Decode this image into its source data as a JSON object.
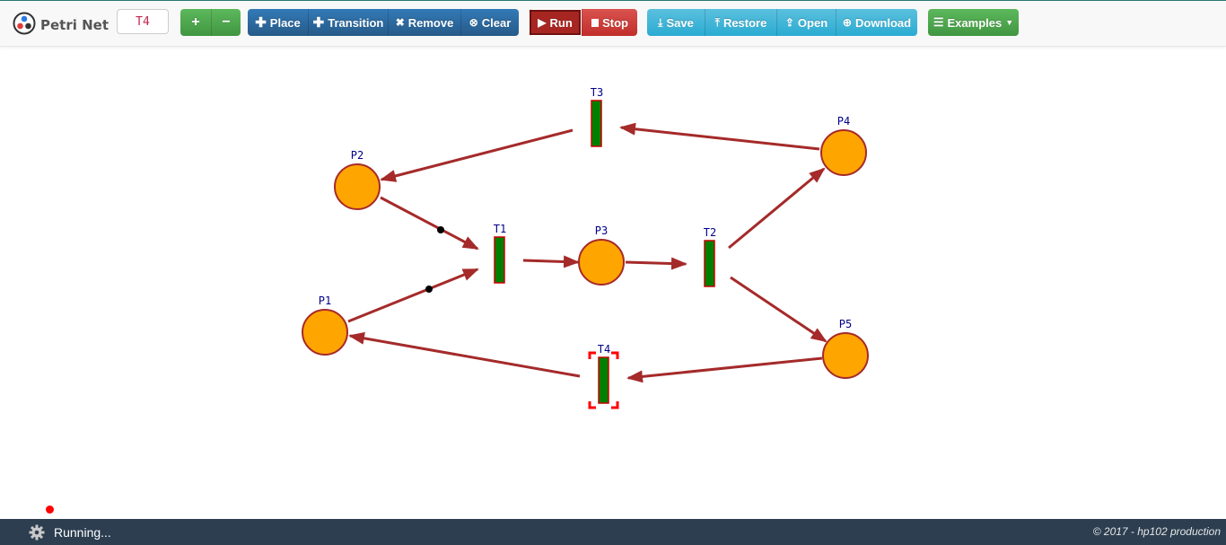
{
  "app": {
    "brand": "Petri Net",
    "selected_element": "T4"
  },
  "toolbar": {
    "zoom_in_label": "+",
    "zoom_out_label": "−",
    "place_label": "Place",
    "transition_label": "Transition",
    "remove_label": "Remove",
    "clear_label": "Clear",
    "run_label": "Run",
    "stop_label": "Stop",
    "save_label": "Save",
    "restore_label": "Restore",
    "open_label": "Open",
    "download_label": "Download",
    "examples_label": "Examples"
  },
  "net": {
    "places": [
      {
        "id": "p1",
        "label": "P1"
      },
      {
        "id": "p2",
        "label": "P2"
      },
      {
        "id": "p3",
        "label": "P3"
      },
      {
        "id": "p4",
        "label": "P4"
      },
      {
        "id": "p5",
        "label": "P5"
      }
    ],
    "transitions": [
      {
        "id": "t1",
        "label": "T1",
        "selected": false
      },
      {
        "id": "t2",
        "label": "T2",
        "selected": false
      },
      {
        "id": "t3",
        "label": "T3",
        "selected": false
      },
      {
        "id": "t4",
        "label": "T4",
        "selected": true
      }
    ],
    "arcs": [
      {
        "from": "P1",
        "to": "T1",
        "tokens_in_transit": 1
      },
      {
        "from": "P2",
        "to": "T1",
        "tokens_in_transit": 1
      },
      {
        "from": "T1",
        "to": "P3",
        "tokens_in_transit": 0
      },
      {
        "from": "P3",
        "to": "T2",
        "tokens_in_transit": 0
      },
      {
        "from": "T2",
        "to": "P4",
        "tokens_in_transit": 0
      },
      {
        "from": "T2",
        "to": "P5",
        "tokens_in_transit": 0
      },
      {
        "from": "P4",
        "to": "T3",
        "tokens_in_transit": 0
      },
      {
        "from": "T3",
        "to": "P2",
        "tokens_in_transit": 0
      },
      {
        "from": "P5",
        "to": "T4",
        "tokens_in_transit": 0
      },
      {
        "from": "T4",
        "to": "P1",
        "tokens_in_transit": 0
      }
    ],
    "colors": {
      "place_fill": "#ffa500",
      "place_stroke": "#a52a2a",
      "transition_fill": "#008000",
      "transition_stroke": "#cc0000",
      "arc": "#a52a2a",
      "label": "#00008b",
      "selection": "#ff0000",
      "token": "#000000"
    }
  },
  "footer": {
    "status": "Running...",
    "copyright": "© 2017 - hp102 production"
  }
}
